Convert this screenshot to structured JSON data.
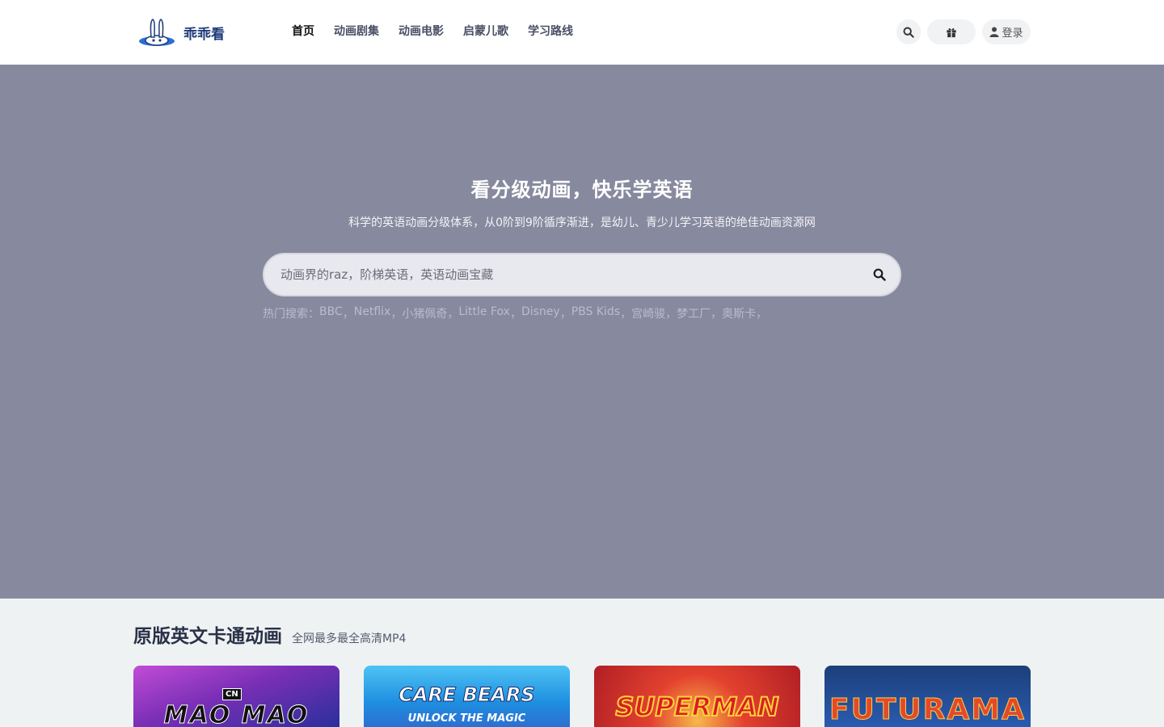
{
  "header": {
    "logo_text": "乖乖看",
    "nav": [
      {
        "label": "首页",
        "active": true
      },
      {
        "label": "动画剧集",
        "active": false
      },
      {
        "label": "动画电影",
        "active": false
      },
      {
        "label": "启蒙儿歌",
        "active": false
      },
      {
        "label": "学习路线",
        "active": false
      }
    ],
    "search_icon": "search-icon",
    "gift_icon": "gift-icon",
    "login_label": "登录",
    "login_icon": "user-icon"
  },
  "hero": {
    "title": "看分级动画，快乐学英语",
    "subtitle": "科学的英语动画分级体系，从0阶到9阶循序渐进，是幼儿、青少儿学习英语的绝佳动画资源网",
    "search_placeholder": "动画界的raz，阶梯英语，英语动画宝藏",
    "hot_label": "热门搜索：",
    "hot_terms": [
      "BBC",
      "Netflix",
      "小猪佩奇",
      "Little Fox",
      "Disney",
      "PBS Kids",
      "宫崎骏",
      "梦工厂",
      "奥斯卡"
    ],
    "separator": "，"
  },
  "section": {
    "title": "原版英文卡通动画",
    "subtitle": "全网最多最全高清MP4"
  },
  "cards": [
    {
      "title": "MAO MAO",
      "badge": "CN"
    },
    {
      "title": "CARE BEARS",
      "subtitle": "UNLOCK THE MAGIC"
    },
    {
      "title": "SUPERMAN"
    },
    {
      "title": "FUTURAMA"
    }
  ],
  "colors": {
    "hero_bg": "#878a9f",
    "header_bg": "#ffffff",
    "brand": "#1f3d7a"
  }
}
